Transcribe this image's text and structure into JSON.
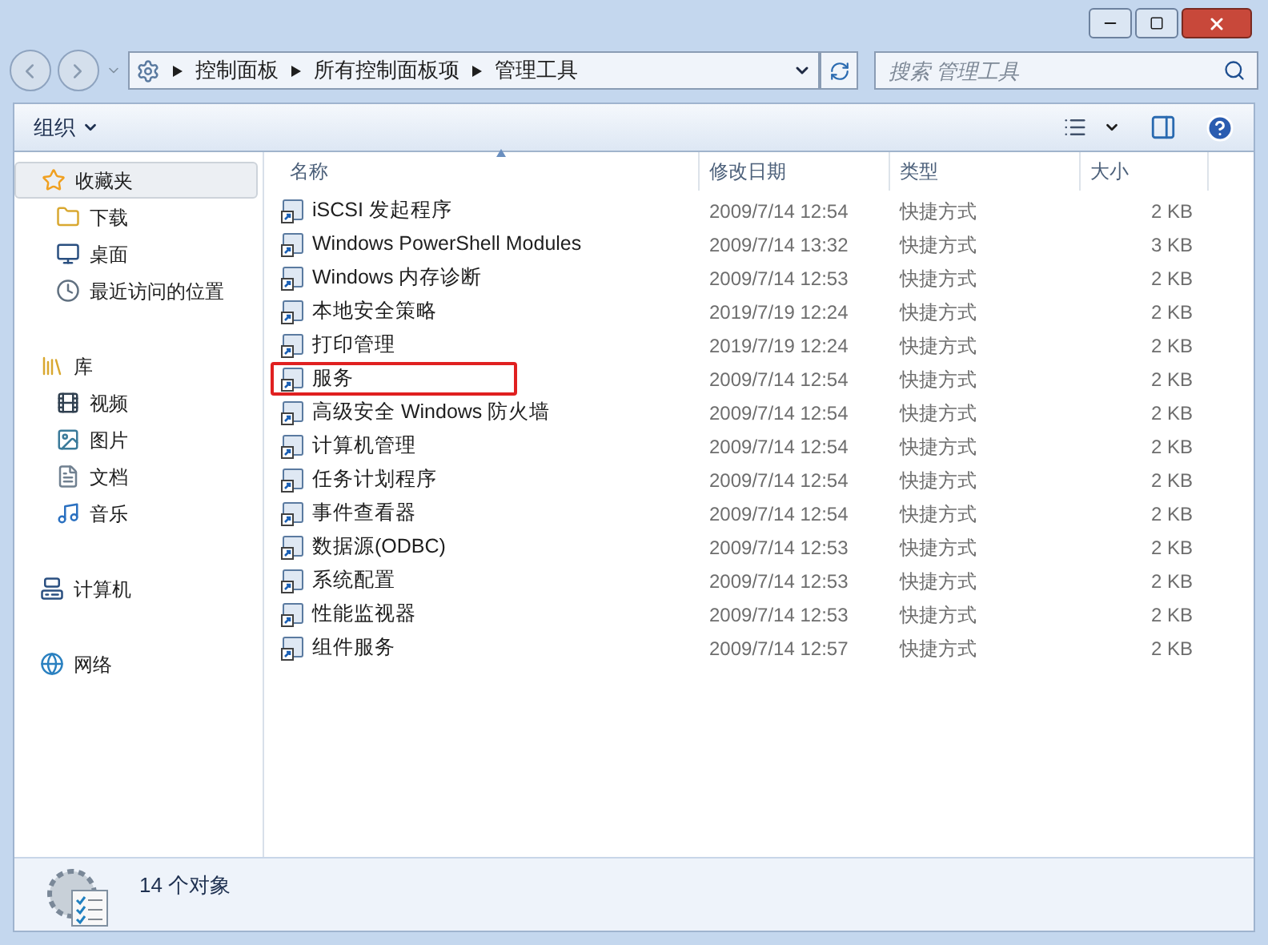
{
  "address_bar": {
    "crumbs": [
      "控制面板",
      "所有控制面板项",
      "管理工具"
    ]
  },
  "search": {
    "placeholder": "搜索 管理工具"
  },
  "toolbar": {
    "organize": "组织"
  },
  "sidebar": {
    "groups": [
      {
        "label": "收藏夹",
        "selected": true,
        "children": [
          {
            "label": "下载",
            "selected": false
          },
          {
            "label": "桌面",
            "selected": false
          },
          {
            "label": "最近访问的位置",
            "selected": false
          }
        ]
      },
      {
        "label": "库",
        "selected": false,
        "children": [
          {
            "label": "视频",
            "selected": false
          },
          {
            "label": "图片",
            "selected": false
          },
          {
            "label": "文档",
            "selected": false
          },
          {
            "label": "音乐",
            "selected": false
          }
        ]
      },
      {
        "label": "计算机",
        "selected": false
      },
      {
        "label": "网络",
        "selected": false
      }
    ]
  },
  "table": {
    "columns": [
      "名称",
      "修改日期",
      "类型",
      "大小"
    ],
    "rows": [
      {
        "name": "iSCSI 发起程序",
        "date": "2009/7/14 12:54",
        "type": "快捷方式",
        "size": "2 KB",
        "annotated": false
      },
      {
        "name": "Windows PowerShell Modules",
        "date": "2009/7/14 13:32",
        "type": "快捷方式",
        "size": "3 KB",
        "annotated": false
      },
      {
        "name": "Windows 内存诊断",
        "date": "2009/7/14 12:53",
        "type": "快捷方式",
        "size": "2 KB",
        "annotated": false
      },
      {
        "name": "本地安全策略",
        "date": "2019/7/19 12:24",
        "type": "快捷方式",
        "size": "2 KB",
        "annotated": false
      },
      {
        "name": "打印管理",
        "date": "2019/7/19 12:24",
        "type": "快捷方式",
        "size": "2 KB",
        "annotated": false
      },
      {
        "name": "服务",
        "date": "2009/7/14 12:54",
        "type": "快捷方式",
        "size": "2 KB",
        "annotated": true
      },
      {
        "name": "高级安全 Windows 防火墙",
        "date": "2009/7/14 12:54",
        "type": "快捷方式",
        "size": "2 KB",
        "annotated": false
      },
      {
        "name": "计算机管理",
        "date": "2009/7/14 12:54",
        "type": "快捷方式",
        "size": "2 KB",
        "annotated": false
      },
      {
        "name": "任务计划程序",
        "date": "2009/7/14 12:54",
        "type": "快捷方式",
        "size": "2 KB",
        "annotated": false
      },
      {
        "name": "事件查看器",
        "date": "2009/7/14 12:54",
        "type": "快捷方式",
        "size": "2 KB",
        "annotated": false
      },
      {
        "name": "数据源(ODBC)",
        "date": "2009/7/14 12:53",
        "type": "快捷方式",
        "size": "2 KB",
        "annotated": false
      },
      {
        "name": "系统配置",
        "date": "2009/7/14 12:53",
        "type": "快捷方式",
        "size": "2 KB",
        "annotated": false
      },
      {
        "name": "性能监视器",
        "date": "2009/7/14 12:53",
        "type": "快捷方式",
        "size": "2 KB",
        "annotated": false
      },
      {
        "name": "组件服务",
        "date": "2009/7/14 12:57",
        "type": "快捷方式",
        "size": "2 KB",
        "annotated": false
      }
    ]
  },
  "status_bar": {
    "count": "14 个对象"
  }
}
